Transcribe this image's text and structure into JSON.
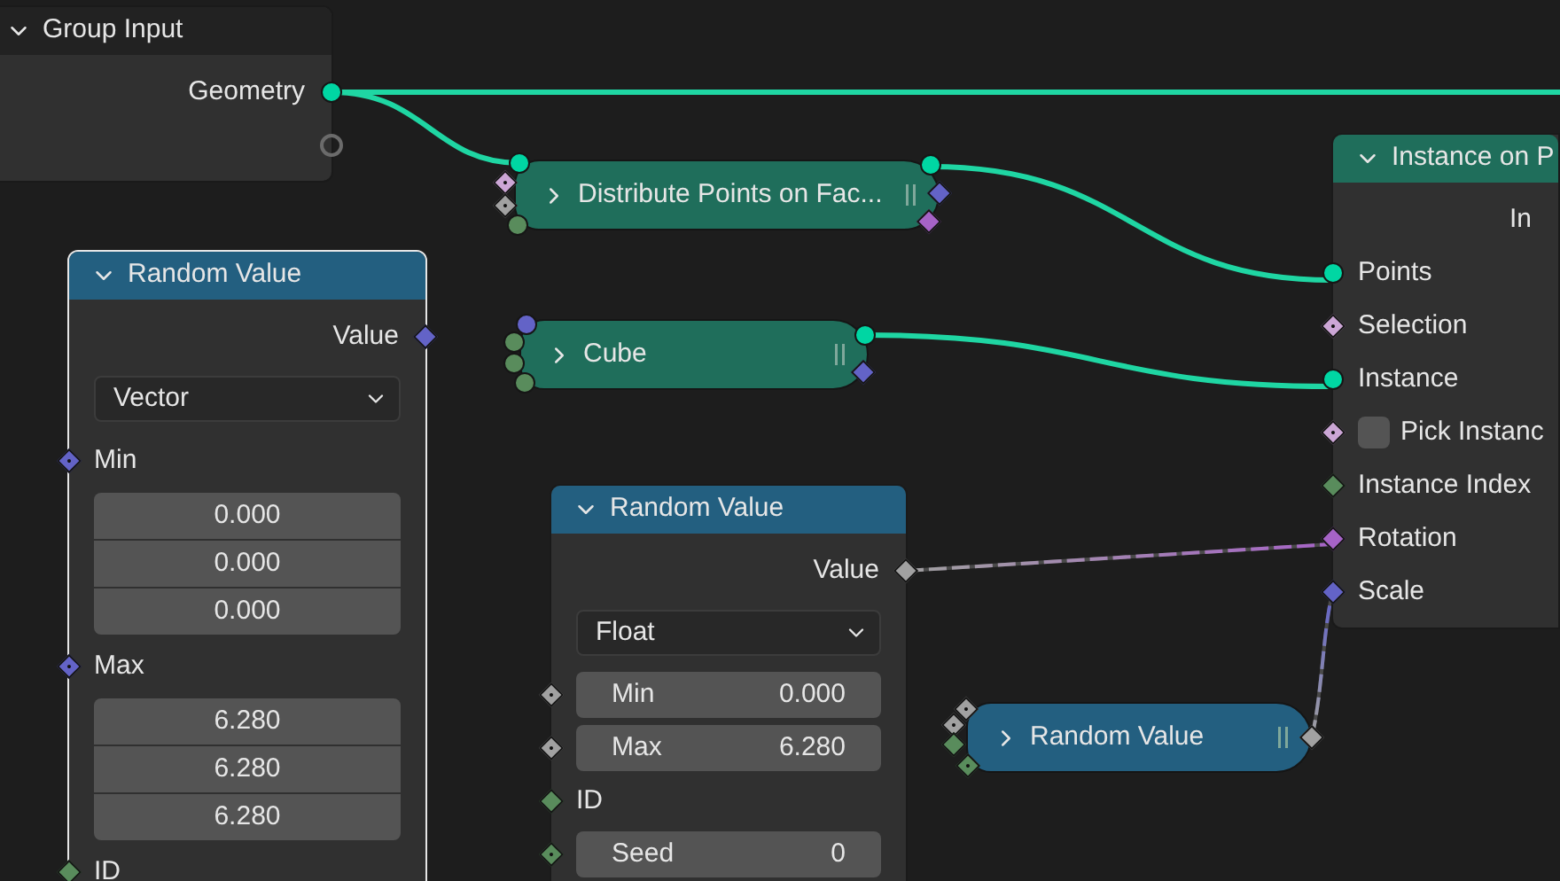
{
  "nodes": [
    {
      "kind": "expanded",
      "title": "Group Input",
      "color": "#222222",
      "selected": false,
      "rows": [
        {
          "kind": "output",
          "label": "Geometry",
          "socket": {
            "kind": "circle",
            "color": "#00d6a3"
          }
        },
        {
          "kind": "socket",
          "socket": {
            "kind": "hollow",
            "color": "#6b6b6b"
          }
        }
      ]
    },
    {
      "kind": "collapsed",
      "title": "Distribute Points on Fac...",
      "color": "#1f6e5b",
      "selected": false,
      "inputs": [
        {
          "kind": "circle",
          "color": "#00d6a3"
        },
        {
          "kind": "diamond-dot",
          "color": "#cca6d6"
        },
        {
          "kind": "diamond-dot",
          "color": "#a1a1a1"
        },
        {
          "kind": "circle",
          "color": "#598c5c"
        }
      ],
      "outputs": [
        {
          "kind": "circle",
          "color": "#00d6a3"
        },
        {
          "kind": "diamond",
          "color": "#6363c7"
        },
        {
          "kind": "diamond",
          "color": "#a663c7"
        }
      ]
    },
    {
      "kind": "expanded",
      "title": "Instance on P",
      "color": "#1f6e5b",
      "selected": false,
      "rows": [
        {
          "kind": "output",
          "label": "In"
        },
        {
          "kind": "input",
          "label": "Points",
          "socket": {
            "kind": "circle",
            "color": "#00d6a3"
          }
        },
        {
          "kind": "input",
          "label": "Selection",
          "socket": {
            "kind": "diamond-dot",
            "color": "#cca6d6"
          }
        },
        {
          "kind": "input",
          "label": "Instance",
          "socket": {
            "kind": "circle",
            "color": "#00d6a3"
          }
        },
        {
          "kind": "checkbox",
          "label": "Pick Instanc",
          "checked": false,
          "socket": {
            "kind": "diamond-dot",
            "color": "#cca6d6"
          }
        },
        {
          "kind": "input",
          "label": "Instance Index",
          "socket": {
            "kind": "diamond",
            "color": "#598c5c"
          }
        },
        {
          "kind": "input",
          "label": "Rotation",
          "socket": {
            "kind": "diamond",
            "color": "#a663c7"
          }
        },
        {
          "kind": "input",
          "label": "Scale",
          "socket": {
            "kind": "diamond",
            "color": "#6363c7"
          }
        }
      ]
    },
    {
      "kind": "expanded",
      "title": "Random Value",
      "color": "#235f80",
      "selected": true,
      "rows": [
        {
          "kind": "output",
          "label": "Value",
          "socket": {
            "kind": "diamond",
            "color": "#6363c7"
          }
        },
        {
          "kind": "dropdown",
          "value": "Vector"
        },
        {
          "kind": "input",
          "label": "Min",
          "socket": {
            "kind": "diamond-dot",
            "color": "#6363c7"
          }
        },
        {
          "kind": "vector",
          "values": [
            "0.000",
            "0.000",
            "0.000"
          ]
        },
        {
          "kind": "input",
          "label": "Max",
          "socket": {
            "kind": "diamond-dot",
            "color": "#6363c7"
          }
        },
        {
          "kind": "vector",
          "values": [
            "6.280",
            "6.280",
            "6.280"
          ]
        },
        {
          "kind": "input",
          "label": "ID",
          "socket": {
            "kind": "diamond",
            "color": "#598c5c"
          }
        }
      ]
    },
    {
      "kind": "collapsed",
      "title": "Cube",
      "color": "#1f6e5b",
      "selected": false,
      "inputs": [
        {
          "kind": "circle",
          "color": "#6363c7"
        },
        {
          "kind": "circle",
          "color": "#598c5c"
        },
        {
          "kind": "circle",
          "color": "#598c5c"
        },
        {
          "kind": "circle",
          "color": "#598c5c"
        }
      ],
      "outputs": [
        {
          "kind": "circle",
          "color": "#00d6a3"
        },
        {
          "kind": "diamond",
          "color": "#6363c7"
        }
      ]
    },
    {
      "kind": "expanded",
      "title": "Random Value",
      "color": "#235f80",
      "selected": false,
      "rows": [
        {
          "kind": "output",
          "label": "Value",
          "socket": {
            "kind": "diamond",
            "color": "#a1a1a1"
          }
        },
        {
          "kind": "dropdown",
          "value": "Float"
        },
        {
          "kind": "field",
          "label": "Min",
          "value": "0.000",
          "socket": {
            "kind": "diamond-dot",
            "color": "#a1a1a1"
          }
        },
        {
          "kind": "field",
          "label": "Max",
          "value": "6.280",
          "socket": {
            "kind": "diamond-dot",
            "color": "#a1a1a1"
          }
        },
        {
          "kind": "input",
          "label": "ID",
          "socket": {
            "kind": "diamond",
            "color": "#598c5c"
          }
        },
        {
          "kind": "field",
          "label": "Seed",
          "value": "0",
          "socket": {
            "kind": "diamond-dot",
            "color": "#598c5c"
          }
        }
      ]
    },
    {
      "kind": "collapsed",
      "title": "Random Value",
      "color": "#235f80",
      "selected": false,
      "inputs": [
        {
          "kind": "diamond-dot",
          "color": "#a1a1a1"
        },
        {
          "kind": "diamond-dot",
          "color": "#a1a1a1"
        },
        {
          "kind": "diamond",
          "color": "#598c5c"
        },
        {
          "kind": "diamond-dot",
          "color": "#598c5c"
        }
      ],
      "outputs": [
        {
          "kind": "diamond",
          "color": "#a1a1a1"
        }
      ]
    }
  ]
}
